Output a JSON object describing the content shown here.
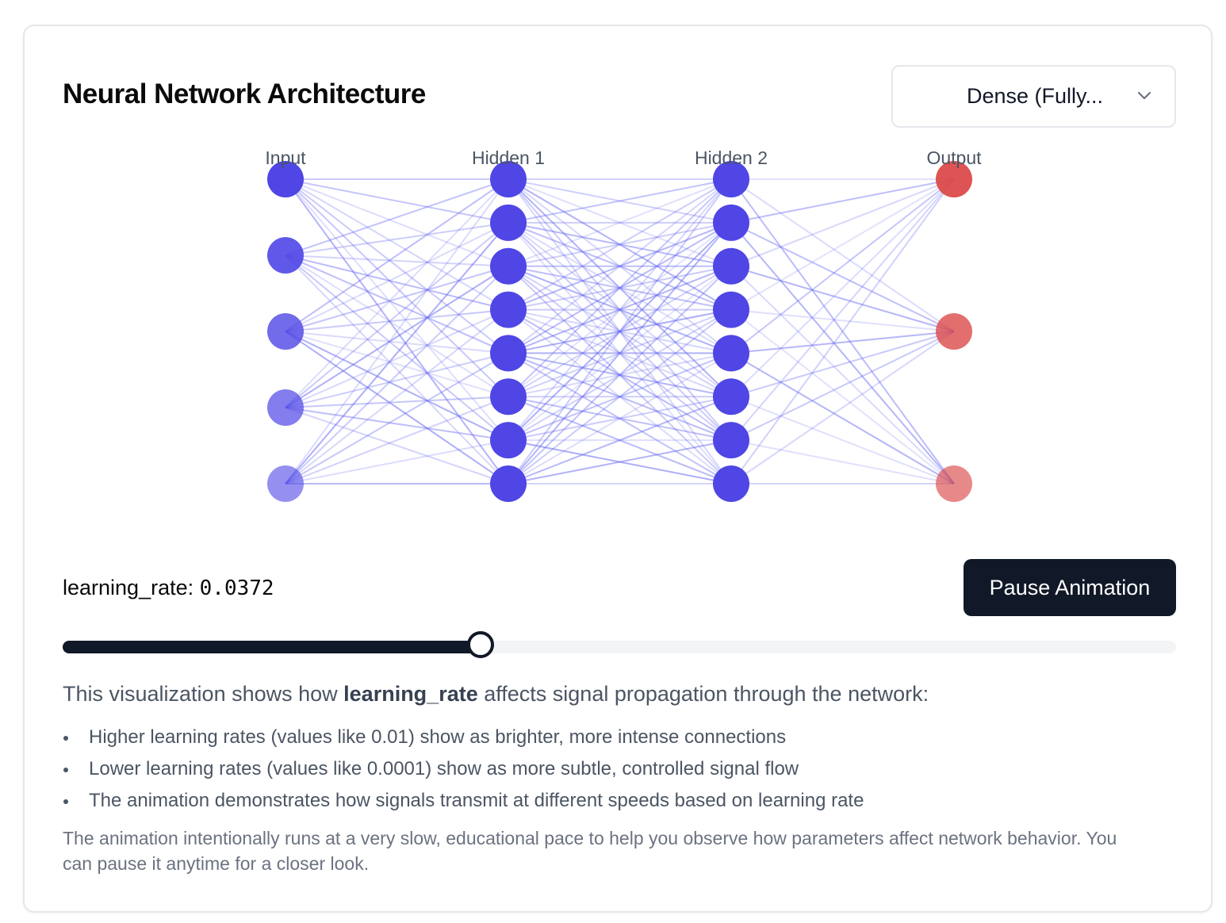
{
  "header": {
    "title": "Neural Network Architecture"
  },
  "architecture_select": {
    "value": "Dense (Fully..."
  },
  "network": {
    "layers": [
      {
        "label": "Input",
        "neurons": 5,
        "color": "#4f46e5"
      },
      {
        "label": "Hidden 1",
        "neurons": 8,
        "color": "#4f46e5"
      },
      {
        "label": "Hidden 2",
        "neurons": 8,
        "color": "#4f46e5"
      },
      {
        "label": "Output",
        "neurons": 3,
        "color": "#dc4a4a"
      }
    ],
    "connection_color": "#6366f1"
  },
  "controls": {
    "param_name": "learning_rate:",
    "param_value": "0.0372",
    "pause_label": "Pause Animation",
    "slider_fraction": 0.375
  },
  "description": {
    "intro_pre": "This visualization shows how ",
    "intro_bold": "learning_rate",
    "intro_post": " affects signal propagation through the network:",
    "bullets": [
      "Higher learning rates (values like 0.01) show as brighter, more intense connections",
      "Lower learning rates (values like 0.0001) show as more subtle, controlled signal flow",
      "The animation demonstrates how signals transmit at different speeds based on learning rate"
    ],
    "note": "The animation intentionally runs at a very slow, educational pace to help you observe how parameters affect network behavior. You can pause it anytime for a closer look."
  },
  "colors": {
    "accent": "#111827",
    "neuron_blue": "#4f46e5",
    "neuron_red": "#dc4a4a"
  }
}
